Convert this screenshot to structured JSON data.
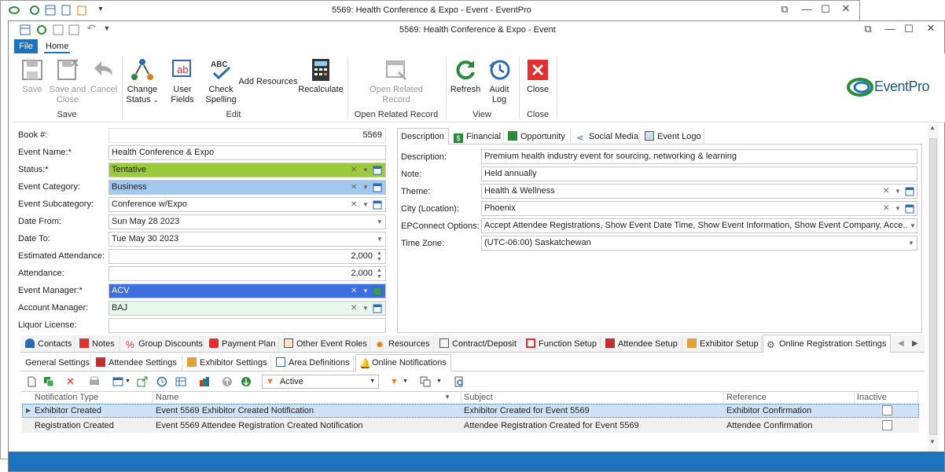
{
  "back_window": {
    "title": "5569: Health Conference & Expo - Event - EventPro"
  },
  "window": {
    "title": "5569: Health Conference & Expo - Event"
  },
  "ribbon": {
    "file_tab": "File",
    "home_tab": "Home",
    "buttons": {
      "save": "Save",
      "save_close_1": "Save and",
      "save_close_2": "Close",
      "cancel": "Cancel",
      "change_status_1": "Change",
      "change_status_2": "Status",
      "user_fields": "User Fields",
      "check_spelling_1": "Check",
      "check_spelling_2": "Spelling",
      "add_resources": "Add Resources",
      "recalculate": "Recalculate",
      "open_related_1": "Open Related",
      "open_related_2": "Record",
      "refresh": "Refresh",
      "audit_log_1": "Audit",
      "audit_log_2": "Log",
      "close": "Close"
    },
    "groups": {
      "save": "Save",
      "edit": "Edit",
      "open_related": "Open Related Record",
      "view": "View",
      "close": "Close"
    },
    "logo_text": "EventPro"
  },
  "form": {
    "book_no": {
      "label": "Book #:",
      "value": "5569"
    },
    "event_name": {
      "label": "Event Name:*",
      "value": "Health Conference & Expo"
    },
    "status": {
      "label": "Status:*",
      "value": "Tentative",
      "color": "#9bcb3c"
    },
    "event_category": {
      "label": "Event Category:",
      "value": "Business",
      "color": "#a3c8f0"
    },
    "event_subcategory": {
      "label": "Event Subcategory:",
      "value": "Conference w/Expo"
    },
    "date_from": {
      "label": "Date From:",
      "value": "Sun May 28 2023"
    },
    "date_to": {
      "label": "Date To:",
      "value": "Tue May 30 2023"
    },
    "estimated_attendance": {
      "label": "Estimated Attendance:",
      "value": "2,000"
    },
    "attendance": {
      "label": "Attendance:",
      "value": "2,000"
    },
    "event_manager": {
      "label": "Event Manager:*",
      "value": "ACV",
      "color": "#3d6fe0"
    },
    "account_manager": {
      "label": "Account Manager:",
      "value": "BAJ",
      "color": "#e8f6ec"
    },
    "liquor_license": {
      "label": "Liquor License:",
      "value": ""
    }
  },
  "right_tabs": [
    "Description",
    "Financial",
    "Opportunity",
    "Social Media",
    "Event Logo"
  ],
  "description": {
    "description": {
      "label": "Description:",
      "value": "Premium health industry event for sourcing, networking & learning"
    },
    "note": {
      "label": "Note:",
      "value": "Held annually"
    },
    "theme": {
      "label": "Theme:",
      "value": "Health & Wellness"
    },
    "city": {
      "label": "City (Location):",
      "value": "Phoenix"
    },
    "epconnect": {
      "label": "EPConnect Options:",
      "value": "Accept Attendee Registrations, Show Event Date Time, Show Event Information, Show Event Company, Acce..."
    },
    "time_zone": {
      "label": "Time Zone:",
      "value": "(UTC-06:00) Saskatchewan"
    }
  },
  "bottom_tabs": [
    "Contacts",
    "Notes",
    "Group Discounts",
    "Payment Plan",
    "Other Event Roles",
    "Resources",
    "Contract/Deposit",
    "Function Setup",
    "Attendee Setup",
    "Exhibitor Setup",
    "Online Registration Settings"
  ],
  "sub_tabs": [
    "General Settings",
    "Attendee Settings",
    "Exhibitor Settings",
    "Area Definitions",
    "Online Notifications"
  ],
  "grid_toolbar": {
    "filter_value": "Active"
  },
  "grid": {
    "columns": [
      "Notification Type",
      "Name",
      "Subject",
      "Reference",
      "Inactive"
    ],
    "rows": [
      {
        "type": "Exhibitor Created",
        "name": "Event 5569 Exhibitor Created Notification",
        "subject": "Exhibitor Created for Event 5569",
        "reference": "Exhibitor Confirmation",
        "inactive": false
      },
      {
        "type": "Registration Created",
        "name": "Event 5569 Attendee Registration Created Notification",
        "subject": "Attendee Registration Created for Event 5569",
        "reference": "Attendee Confirmation",
        "inactive": false
      }
    ]
  }
}
